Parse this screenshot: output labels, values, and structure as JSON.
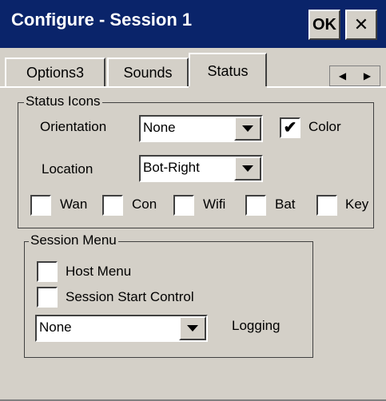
{
  "window": {
    "title": "Configure - Session 1",
    "ok_label": "OK",
    "close_label": "✕"
  },
  "tabs": [
    {
      "label": "Options3",
      "active": false
    },
    {
      "label": "Sounds",
      "active": false
    },
    {
      "label": "Status",
      "active": true
    }
  ],
  "status_icons": {
    "group_label": "Status Icons",
    "orientation_label": "Orientation",
    "orientation_value": "None",
    "color_label": "Color",
    "color_checked": true,
    "location_label": "Location",
    "location_value": "Bot-Right",
    "indicators": [
      {
        "label": "Wan",
        "checked": false
      },
      {
        "label": "Con",
        "checked": false
      },
      {
        "label": "Wifi",
        "checked": false
      },
      {
        "label": "Bat",
        "checked": false
      },
      {
        "label": "Key",
        "checked": false
      }
    ]
  },
  "session_menu": {
    "group_label": "Session Menu",
    "host_menu_label": "Host Menu",
    "host_menu_checked": false,
    "session_start_label": "Session Start Control",
    "session_start_checked": false,
    "logging_value": "None",
    "logging_label": "Logging"
  },
  "colors": {
    "titlebar": "#0a246a",
    "face": "#d4d0c8"
  }
}
